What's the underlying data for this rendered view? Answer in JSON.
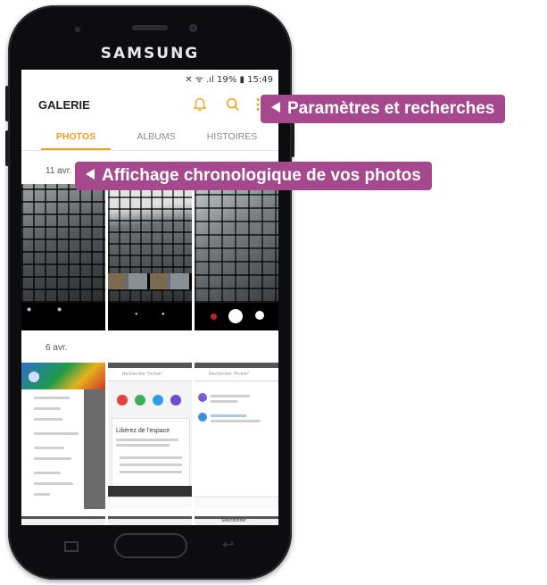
{
  "device": {
    "brand": "SAMSUNG"
  },
  "status_bar": {
    "battery": "19%",
    "time": "15:49"
  },
  "app": {
    "title": "GALERIE"
  },
  "icons": {
    "notifications": "bell-icon",
    "search": "search-icon",
    "more": "more-vertical-icon"
  },
  "colors": {
    "accent": "#f0a020",
    "callout": "#a5488d"
  },
  "tabs": [
    {
      "label": "PHOTOS",
      "active": true
    },
    {
      "label": "ALBUMS",
      "active": false
    },
    {
      "label": "HISTOIRES",
      "active": false
    }
  ],
  "sections": [
    {
      "date": "11 avr."
    },
    {
      "date": "6 avr."
    }
  ],
  "thumbnails": {
    "shot1_search": "Rechercher \"Fichier\"",
    "shot2_search": "Rechercher \"Fichier\"",
    "shot2_heading": "Libérez de l'espace",
    "shot3_title": "Sélectionner"
  },
  "annotations": {
    "settings": "Paramètres et recherches",
    "timeline": "Affichage chronologique de vos photos"
  }
}
